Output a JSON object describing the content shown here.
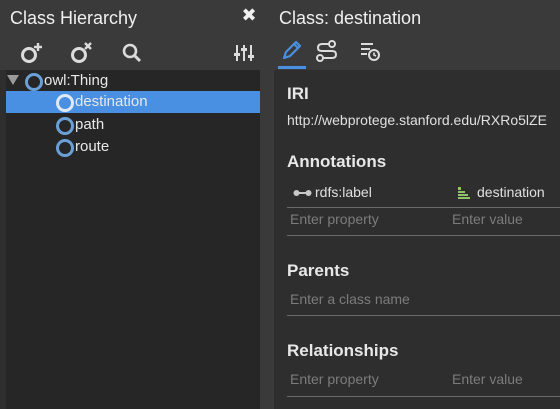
{
  "class_hierarchy": {
    "title": "Class Hierarchy",
    "close_symbol": "✖",
    "toolbar": [
      "add-class-icon",
      "delete-class-icon",
      "search-icon",
      "settings-sliders-icon"
    ],
    "tree": {
      "root": {
        "label": "owl:Thing",
        "expanded": true
      },
      "children": [
        {
          "label": "destination",
          "selected": true
        },
        {
          "label": "path",
          "selected": false
        },
        {
          "label": "route",
          "selected": false
        }
      ]
    }
  },
  "class_editor": {
    "title": "Class: destination",
    "tabs": [
      "edit-pencil-icon",
      "relationships-path-icon",
      "history-list-icon"
    ],
    "active_tab": 0,
    "iri": {
      "heading": "IRI",
      "value": "http://webprotege.stanford.edu/RXRo5lZE"
    },
    "annotations": {
      "heading": "Annotations",
      "rows": [
        {
          "property": "rdfs:label",
          "value": "destination"
        }
      ],
      "property_placeholder": "Enter property",
      "value_placeholder": "Enter value"
    },
    "parents": {
      "heading": "Parents",
      "placeholder": "Enter a class name"
    },
    "relationships": {
      "heading": "Relationships",
      "property_placeholder": "Enter property",
      "value_placeholder": "Enter value"
    }
  },
  "colors": {
    "accent": "#4a90e2",
    "node_icon": "#6aa0d8",
    "panel": "#2e2e2e",
    "header": "#3a3a3a"
  }
}
